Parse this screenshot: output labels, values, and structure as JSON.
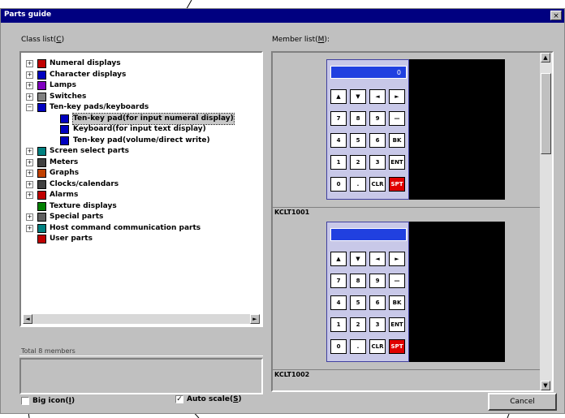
{
  "window": {
    "title": "Parts guide",
    "close_glyph": "×"
  },
  "labels": {
    "class_list": "Class list(",
    "class_list_key": "C",
    "class_list_end": ")",
    "member_list": "Member list(",
    "member_list_key": "M",
    "member_list_end": "):"
  },
  "tree": [
    {
      "label": "Numeral displays",
      "expander": "+",
      "icon": "numeral-display-icon",
      "color": "#c00000"
    },
    {
      "label": "Character displays",
      "expander": "+",
      "icon": "character-display-icon",
      "color": "#0000c0"
    },
    {
      "label": "Lamps",
      "expander": "+",
      "icon": "lamp-icon",
      "color": "#8000c0"
    },
    {
      "label": "Switches",
      "expander": "+",
      "icon": "switch-icon",
      "color": "#808080"
    },
    {
      "label": "Ten-key pads/keyboards",
      "expander": "−",
      "icon": "keypad-icon",
      "color": "#0000c0"
    },
    {
      "label": "Ten-key pad(for input numeral display)",
      "expander": "",
      "icon": "keypad-item-icon",
      "color": "#0000c0"
    },
    {
      "label": "Keyboard(for input text display)",
      "expander": "",
      "icon": "keyboard-item-icon",
      "color": "#0000c0"
    },
    {
      "label": "Ten-key pad(volume/direct write)",
      "expander": "",
      "icon": "keypad-item-icon",
      "color": "#0000c0"
    },
    {
      "label": "Screen select parts",
      "expander": "+",
      "icon": "screen-select-icon",
      "color": "#008080"
    },
    {
      "label": "Meters",
      "expander": "+",
      "icon": "meter-icon",
      "color": "#404040"
    },
    {
      "label": "Graphs",
      "expander": "+",
      "icon": "graph-icon",
      "color": "#c04000"
    },
    {
      "label": "Clocks/calendars",
      "expander": "+",
      "icon": "clock-icon",
      "color": "#404040"
    },
    {
      "label": "Alarms",
      "expander": "+",
      "icon": "alarm-icon",
      "color": "#c00000"
    },
    {
      "label": "Texture displays",
      "expander": "",
      "icon": "texture-icon",
      "color": "#008000"
    },
    {
      "label": "Special parts",
      "expander": "+",
      "icon": "special-parts-icon",
      "color": "#606060"
    },
    {
      "label": "Host command communication parts",
      "expander": "+",
      "icon": "host-command-icon",
      "color": "#008080"
    },
    {
      "label": "User parts",
      "expander": "",
      "icon": "user-parts-icon",
      "color": "#c00000"
    }
  ],
  "selected_index": 5,
  "scroll": {
    "left": "◄",
    "right": "►",
    "up": "▲",
    "down": "▼"
  },
  "status": {
    "text": "Total 8 members"
  },
  "checkboxes": {
    "big_icon": {
      "label": "Big icon(",
      "key": "I",
      "end": ")",
      "checked": false,
      "mark": ""
    },
    "auto_scale": {
      "label": "Auto scale(",
      "key": "S",
      "end": ")",
      "checked": true,
      "mark": "✓"
    }
  },
  "members": [
    {
      "name": "KCLT1001",
      "display_text": "0",
      "keys": [
        "▲",
        "▼",
        "◄",
        "►",
        "7",
        "8",
        "9",
        "—",
        "4",
        "5",
        "6",
        "BK",
        "1",
        "2",
        "3",
        "ENT",
        "0",
        ".",
        "CLR",
        "SPT"
      ]
    },
    {
      "name": "KCLT1002",
      "display_text": "",
      "keys": [
        "▲",
        "▼",
        "◄",
        "►",
        "7",
        "8",
        "9",
        "—",
        "4",
        "5",
        "6",
        "BK",
        "1",
        "2",
        "3",
        "ENT",
        "0",
        ".",
        "CLR",
        "SPT"
      ]
    }
  ],
  "buttons": {
    "cancel": "Cancel"
  },
  "colors": {
    "titlebar": "#000080",
    "selected_key_red": "#e00000",
    "keypad_display": "#2040e0"
  }
}
